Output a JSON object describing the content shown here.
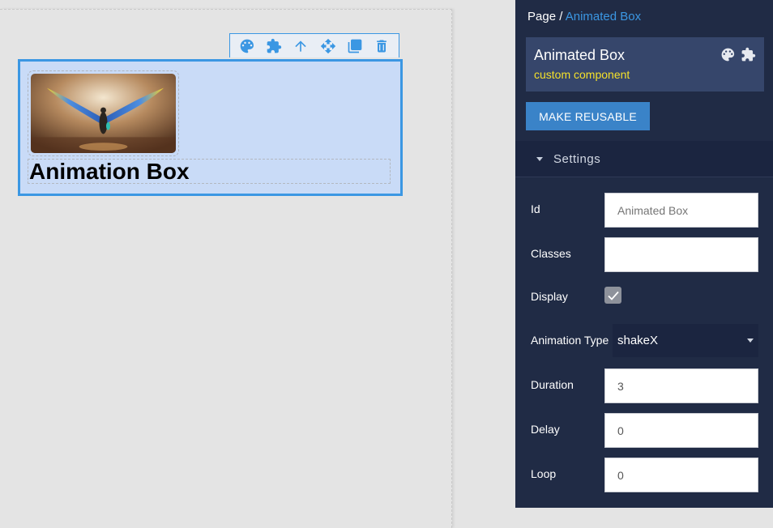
{
  "canvas": {
    "toolbar": {
      "icons": [
        "palette-icon",
        "puzzle-icon",
        "arrow-up-icon",
        "move-icon",
        "copy-icon",
        "trash-icon"
      ]
    },
    "animated_box": {
      "title": "Animation Box",
      "image": "winged-figure-image"
    }
  },
  "panel": {
    "breadcrumb": {
      "root": "Page",
      "separator": " / ",
      "current": "Animated Box"
    },
    "component": {
      "name": "Animated Box",
      "subtitle": "custom component",
      "icons": [
        "palette-icon",
        "puzzle-icon"
      ]
    },
    "make_reusable_label": "MAKE REUSABLE",
    "settings": {
      "title": "Settings",
      "fields": {
        "id": {
          "label": "Id",
          "value": "",
          "placeholder": "Animated Box"
        },
        "classes": {
          "label": "Classes",
          "value": ""
        },
        "display": {
          "label": "Display",
          "checked": true
        },
        "animation_type": {
          "label": "Animation Type",
          "value": "shakeX"
        },
        "duration": {
          "label": "Duration",
          "value": "3"
        },
        "delay": {
          "label": "Delay",
          "value": "0"
        },
        "loop": {
          "label": "Loop",
          "value": "0"
        }
      }
    }
  },
  "colors": {
    "accent": "#3b97e3",
    "panel_bg": "#202b45",
    "component_card": "#36466b",
    "subtitle": "#f5e12a",
    "selection_fill": "#c9dbf7",
    "canvas_bg": "#e4e4e4"
  }
}
